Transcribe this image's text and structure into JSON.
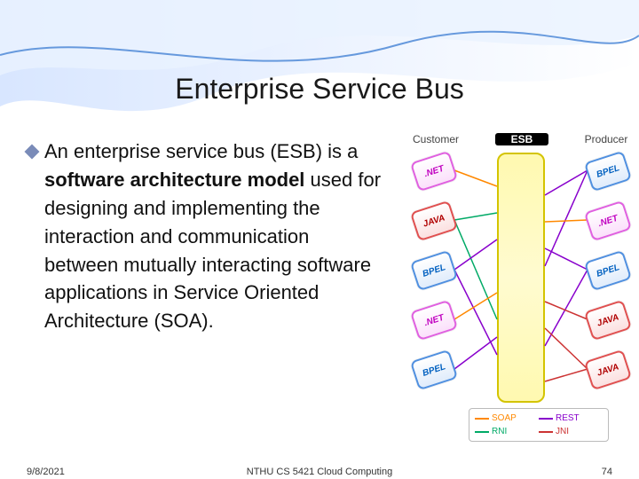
{
  "title": "Enterprise Service Bus",
  "bullet": {
    "pre": "An enterprise service bus (ESB) is a ",
    "strong": "software architecture model",
    "post": " used for designing and implementing the interaction and communication between mutually interacting software applications in Service Oriented Architecture (SOA)."
  },
  "diagram": {
    "columns": {
      "left": "Customer",
      "mid": "ESB",
      "right": "Producer"
    },
    "nodes": {
      "left": [
        ".NET",
        "JAVA",
        "BPEL",
        ".NET",
        "BPEL"
      ],
      "right": [
        "BPEL",
        ".NET",
        "BPEL",
        "JAVA",
        "JAVA"
      ]
    },
    "legend": {
      "soap": "SOAP",
      "rest": "REST",
      "rni": "RNI",
      "jni": "JNI"
    }
  },
  "footer": {
    "date": "9/8/2021",
    "center": "NTHU CS 5421 Cloud Computing",
    "page": "74"
  }
}
